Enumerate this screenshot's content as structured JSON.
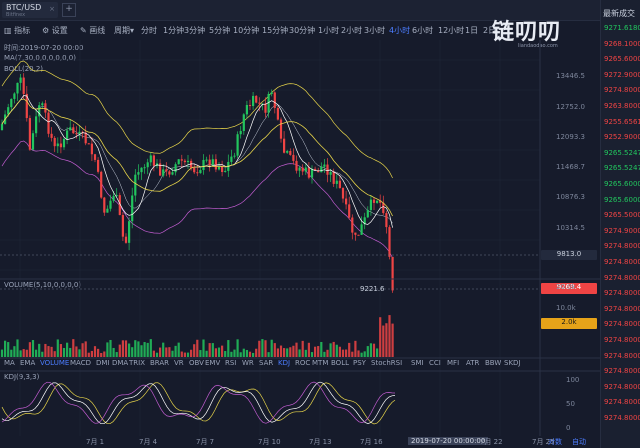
{
  "tab": {
    "symbol": "BTC/USD",
    "exchange": "Bitfinex",
    "close": "×",
    "add": "+"
  },
  "toolbar": {
    "indicators": "指标",
    "settings": "设置",
    "draw": "画线",
    "period": "周期",
    "intervals": [
      "分时",
      "1分钟",
      "3分钟",
      "5分钟",
      "10分钟",
      "15分钟",
      "30分钟",
      "1小时",
      "2小时",
      "3小时",
      "4小时",
      "6小时",
      "12小时",
      "1日",
      "2日"
    ],
    "active_interval": "4小时"
  },
  "logo": {
    "text": "链叨叨",
    "sub": "liandaodao.com"
  },
  "legend": {
    "time": "时间:2019-07-20 00:00",
    "ma": "MA(7,30,0,0,0,0,0,0)",
    "boll": "BOLL(20,2)",
    "volume": "VOLUME(5,10,0,0,0,0)",
    "kdj": "KDJ(9,3,3)"
  },
  "price_axis": [
    "13446.5",
    "12752.0",
    "12093.3",
    "11468.7",
    "10876.3",
    "10314.5",
    "9813.0",
    "9269.4"
  ],
  "volume_axis": [
    "20.0k",
    "10.0k",
    "2.0k"
  ],
  "kdj_axis": [
    "100",
    "50",
    "0"
  ],
  "last_label": "9221.6",
  "indicator_tabs": [
    "MA",
    "EMA",
    "VOLUME",
    "MACD",
    "DMI",
    "DMA",
    "TRIX",
    "BRAR",
    "VR",
    "OBV",
    "EMV",
    "RSI",
    "WR",
    "SAR",
    "KDJ",
    "ROC",
    "MTM",
    "BOLL",
    "PSY",
    "StochRSI",
    "SMI",
    "CCI",
    "MFI",
    "ATR",
    "BBW",
    "SKDJ"
  ],
  "active_indicator_tabs": [
    "VOLUME",
    "KDJ"
  ],
  "date_labels": [
    "7月 1",
    "7月 4",
    "7月 7",
    "7月 10",
    "7月 13",
    "7月 16",
    "7月 22",
    "7月 25"
  ],
  "date_cursor": "2019-07-20 00:00:00",
  "bottom_right": {
    "compare": "对数",
    "auto": "自动"
  },
  "side_panel": {
    "title": "最新成交",
    "prices": [
      "9271.6180",
      "9268.1000",
      "9265.6000",
      "9272.9000",
      "9274.8000",
      "9263.8000",
      "9255.6561",
      "9252.9000",
      "9265.5247",
      "9265.5247",
      "9265.6000",
      "9265.6000",
      "9265.5000",
      "9274.9000",
      "9274.8000",
      "9274.8000",
      "9274.8000",
      "9274.8000",
      "9274.8000",
      "9274.8000",
      "9274.8000",
      "9274.8000",
      "9274.8000",
      "9274.8000",
      "9274.8000",
      "9274.8000"
    ],
    "colors": [
      "#22c55e",
      "#ef4444",
      "#ef4444",
      "#ef4444",
      "#ef4444",
      "#ef4444",
      "#ef4444",
      "#ef4444",
      "#22c55e",
      "#22c55e",
      "#22c55e",
      "#22c55e",
      "#ef4444",
      "#ef4444",
      "#ef4444",
      "#ef4444",
      "#ef4444",
      "#ef4444",
      "#ef4444",
      "#ef4444",
      "#ef4444",
      "#ef4444",
      "#ef4444",
      "#ef4444",
      "#ef4444",
      "#ef4444"
    ]
  },
  "colors": {
    "up": "#22c55e",
    "down": "#ef4444",
    "ma7": "#ffffff",
    "ma30": "#e6d44a",
    "boll": "#c05ccf",
    "accent": "#4c7dff"
  }
}
